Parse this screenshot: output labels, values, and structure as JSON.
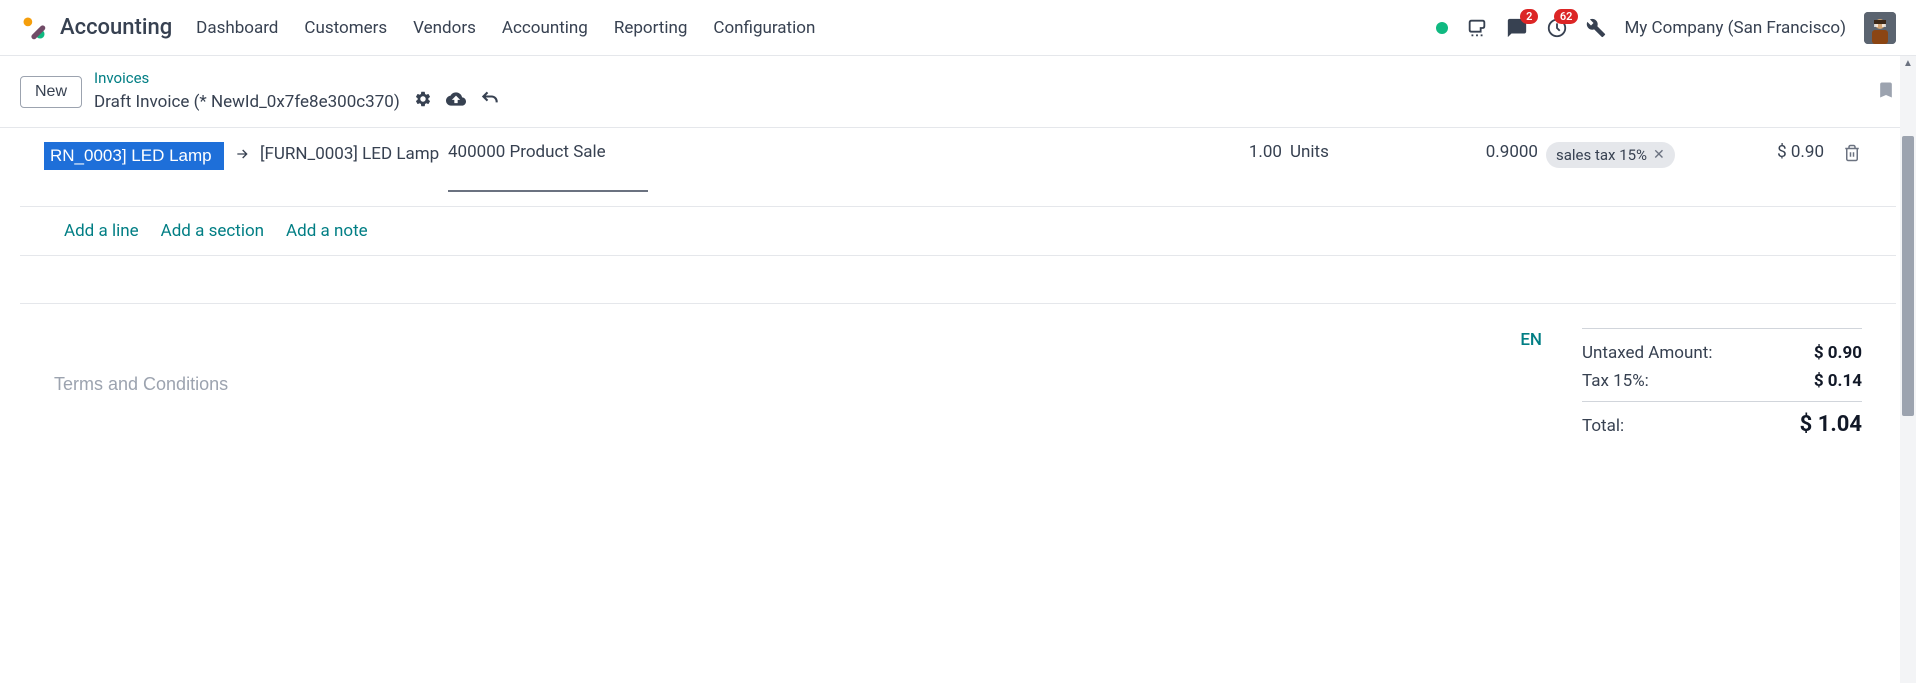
{
  "app": {
    "title": "Accounting"
  },
  "nav": {
    "items": [
      "Dashboard",
      "Customers",
      "Vendors",
      "Accounting",
      "Reporting",
      "Configuration"
    ]
  },
  "header_right": {
    "company": "My Company (San Francisco)",
    "messages_badge": "2",
    "activities_badge": "62"
  },
  "sub": {
    "new_label": "New",
    "breadcrumb_parent": "Invoices",
    "breadcrumb_current": "Draft Invoice (* NewId_0x7fe8e300c370)"
  },
  "line": {
    "product_input": "RN_0003] LED Lamp",
    "product_label": "[FURN_0003] LED Lamp",
    "account": "400000 Product Sale",
    "qty": "1.00",
    "uom": "Units",
    "price": "0.9000",
    "tax_label": "sales tax 15%",
    "subtotal": "$ 0.90"
  },
  "add": {
    "line": "Add a line",
    "section": "Add a section",
    "note": "Add a note"
  },
  "footer": {
    "terms_placeholder": "Terms and Conditions",
    "lang": "EN"
  },
  "totals": {
    "untaxed_label": "Untaxed Amount:",
    "untaxed_value": "$ 0.90",
    "tax_label": "Tax 15%:",
    "tax_value": "$ 0.14",
    "total_label": "Total:",
    "total_value": "$ 1.04"
  }
}
